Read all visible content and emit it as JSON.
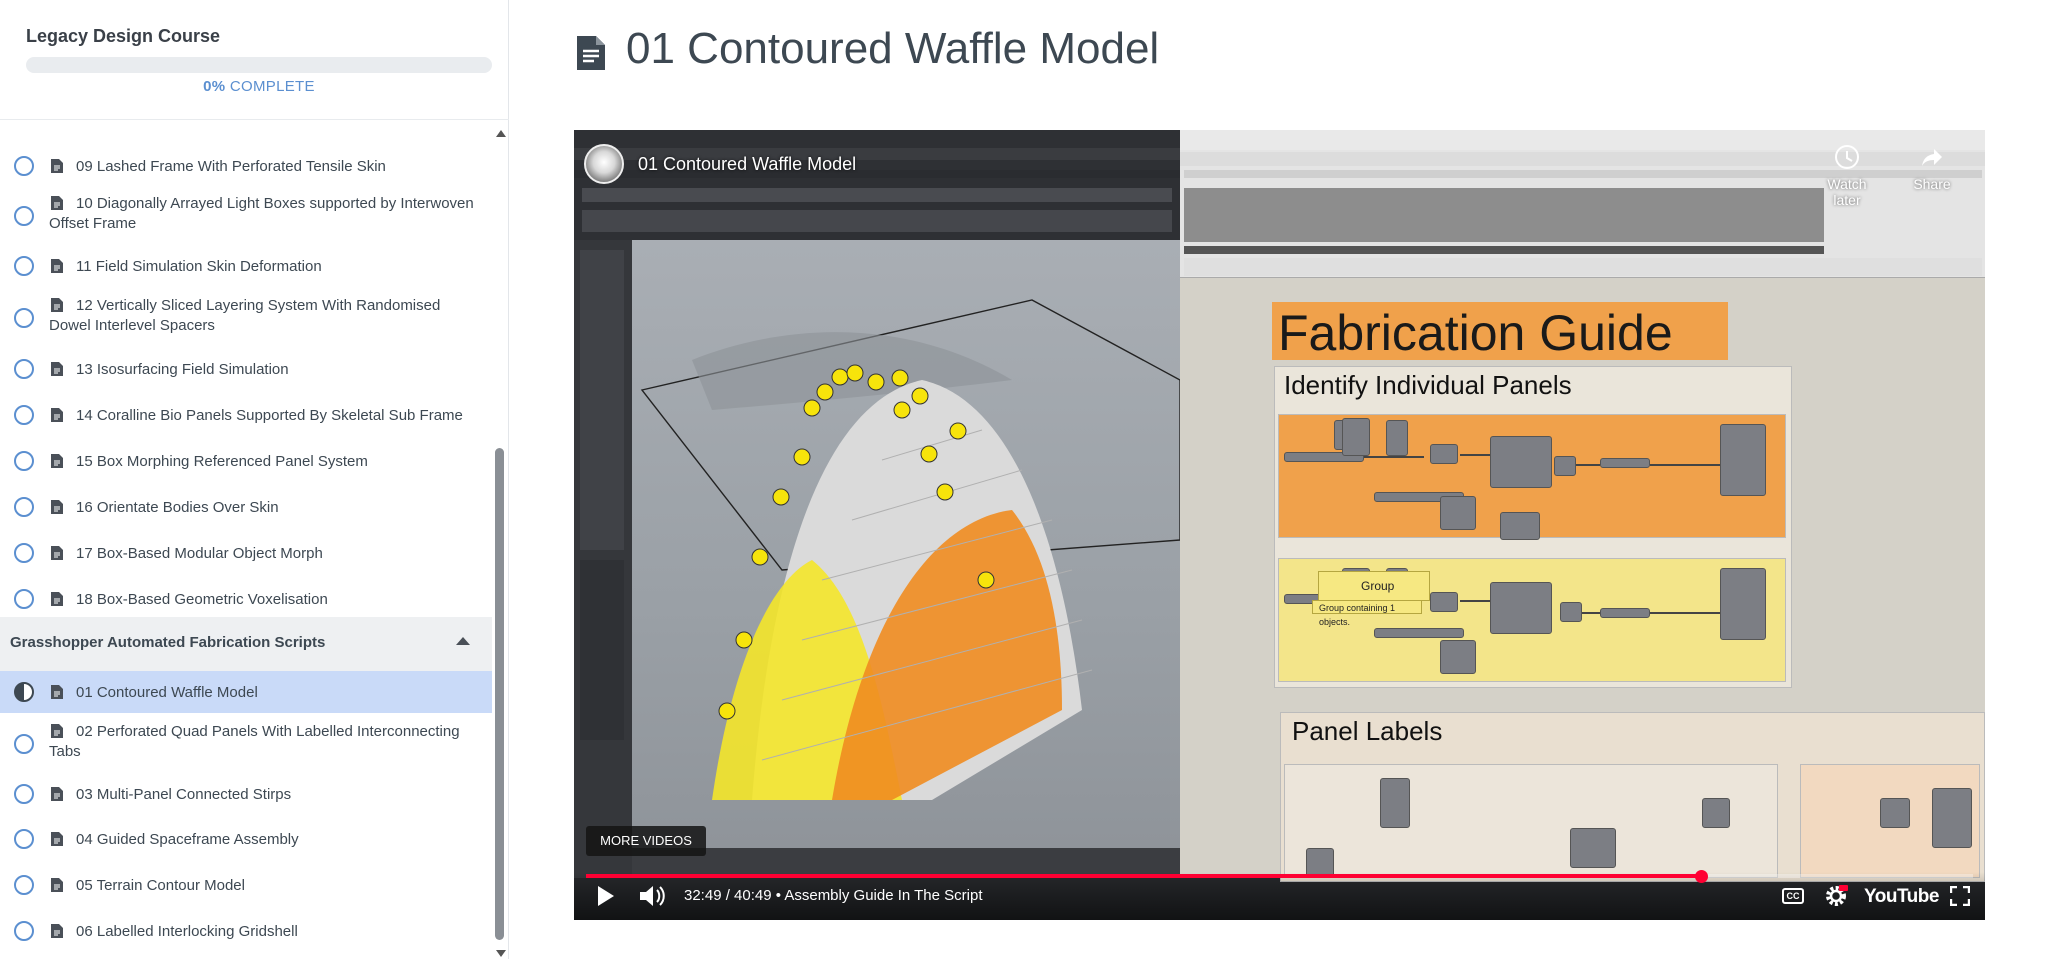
{
  "sidebar": {
    "course_title": "Legacy Design Course",
    "progress_percent": "0%",
    "progress_label": "COMPLETE",
    "progress_value": 0,
    "lessons_before": [
      {
        "label": "09 Lashed Frame With Perforated Tensile Skin",
        "status": "incomplete"
      },
      {
        "label": "10 Diagonally Arrayed Light Boxes supported by Interwoven Offset Frame",
        "status": "incomplete"
      },
      {
        "label": "11 Field Simulation Skin Deformation",
        "status": "incomplete"
      },
      {
        "label": "12 Vertically Sliced Layering System With Randomised Dowel Interlevel Spacers",
        "status": "incomplete"
      },
      {
        "label": "13 Isosurfacing Field Simulation",
        "status": "incomplete"
      },
      {
        "label": "14 Coralline Bio Panels Supported By Skeletal Sub Frame",
        "status": "incomplete"
      },
      {
        "label": "15 Box Morphing Referenced Panel System",
        "status": "incomplete"
      },
      {
        "label": "16 Orientate Bodies Over Skin",
        "status": "incomplete"
      },
      {
        "label": "17 Box-Based Modular Object Morph",
        "status": "incomplete"
      },
      {
        "label": "18 Box-Based Geometric Voxelisation",
        "status": "incomplete"
      }
    ],
    "section_title": "Grasshopper Automated Fabrication Scripts",
    "lessons_after": [
      {
        "label": "01 Contoured Waffle Model",
        "status": "in-progress",
        "active": true
      },
      {
        "label": "02 Perforated Quad Panels With Labelled Interconnecting Tabs",
        "status": "incomplete"
      },
      {
        "label": "03 Multi-Panel Connected Stirps",
        "status": "incomplete"
      },
      {
        "label": "04 Guided Spaceframe Assembly",
        "status": "incomplete"
      },
      {
        "label": "05 Terrain Contour Model",
        "status": "incomplete"
      },
      {
        "label": "06 Labelled Interlocking Gridshell",
        "status": "incomplete"
      }
    ]
  },
  "main": {
    "page_title": "01 Contoured Waffle Model"
  },
  "video": {
    "title": "01 Contoured Waffle Model",
    "watch_later": "Watch later",
    "share": "Share",
    "more_videos": "MORE VIDEOS",
    "time": "32:49 / 40:49",
    "chapter": "Assembly Guide In The Script",
    "progress_fraction": 0.804,
    "cc": "CC",
    "youtube": "YouTube",
    "inner": {
      "fabrication_guide": "Fabrication Guide",
      "identify_panels": "Identify Individual Panels",
      "panel_labels": "Panel Labels",
      "tooltip_title": "Group",
      "tooltip_sub": "Group containing 1 objects."
    }
  },
  "colors": {
    "accent": "#5b8fd0",
    "active_row": "#c9daf8",
    "seek": "#ff0033",
    "orange_group": "#f0a14b",
    "yellow_group": "#f3e58a"
  }
}
